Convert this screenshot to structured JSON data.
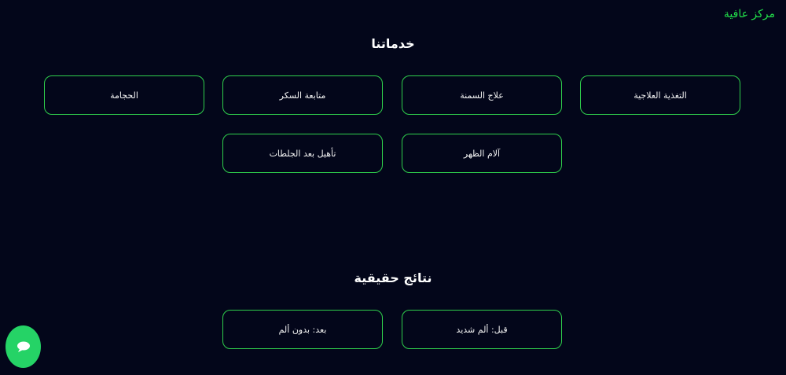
{
  "brand": {
    "name": "مركز عافية"
  },
  "services": {
    "title": "خدماتنا",
    "items": [
      "التغذية العلاجية",
      "علاج السمنة",
      "متابعة السكر",
      "الحجامة",
      "آلام الظهر",
      "تأهيل بعد الجلطات"
    ]
  },
  "results": {
    "title": "نتائج حقيقية",
    "items": [
      "قبل: ألم شديد",
      "بعد: بدون ألم"
    ]
  },
  "colors": {
    "background": "#03061a",
    "accent": "#22e04a",
    "chat_button": "#25d366"
  },
  "chat": {
    "icon": "chat-bubble-icon"
  }
}
